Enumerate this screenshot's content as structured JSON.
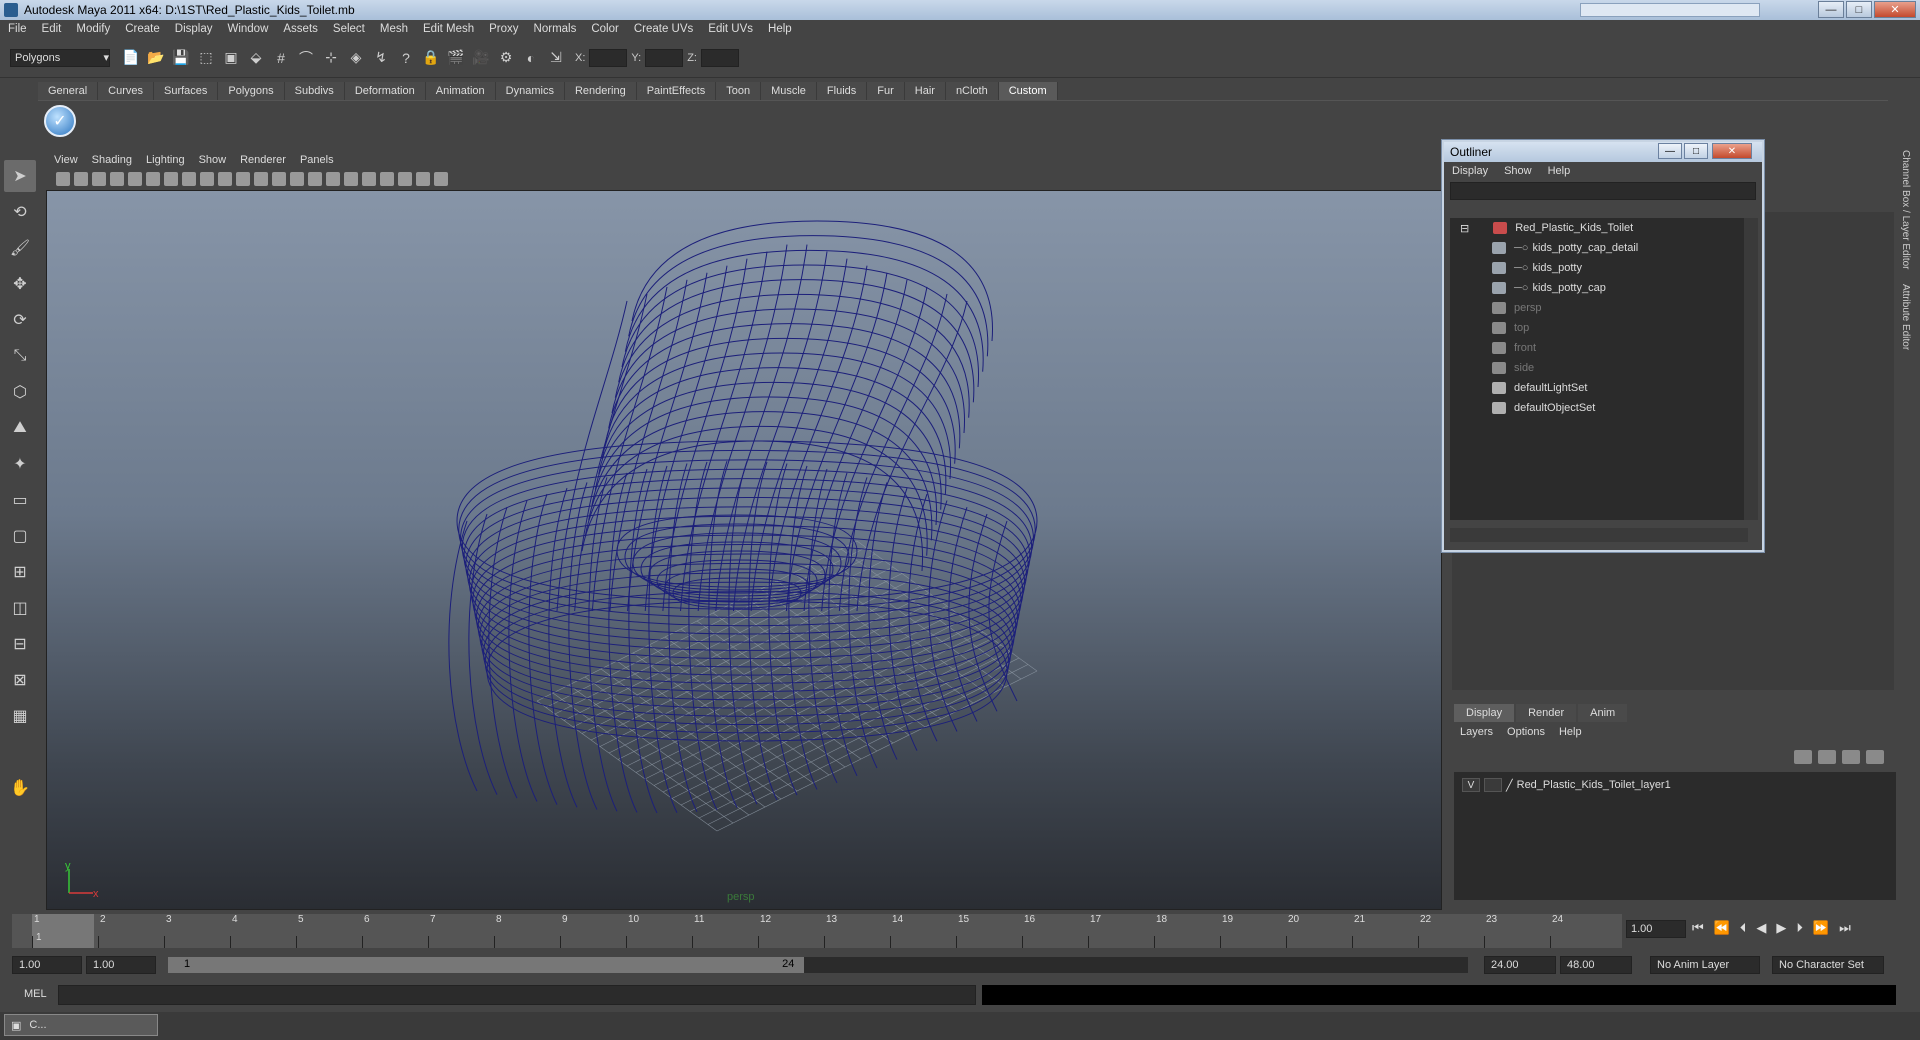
{
  "app": {
    "title": "Autodesk Maya 2011 x64: D:\\1ST\\Red_Plastic_Kids_Toilet.mb",
    "window_buttons": [
      "—",
      "□",
      "✕"
    ]
  },
  "menubar": [
    "File",
    "Edit",
    "Modify",
    "Create",
    "Display",
    "Window",
    "Assets",
    "Select",
    "Mesh",
    "Edit Mesh",
    "Proxy",
    "Normals",
    "Color",
    "Create UVs",
    "Edit UVs",
    "Help"
  ],
  "status_line": {
    "mode": "Polygons",
    "x_label": "X:",
    "y_label": "Y:",
    "z_label": "Z:"
  },
  "shelf": {
    "tabs": [
      "General",
      "Curves",
      "Surfaces",
      "Polygons",
      "Subdivs",
      "Deformation",
      "Animation",
      "Dynamics",
      "Rendering",
      "PaintEffects",
      "Toon",
      "Muscle",
      "Fluids",
      "Fur",
      "Hair",
      "nCloth",
      "Custom"
    ],
    "active_tab": "Custom"
  },
  "viewport": {
    "menu": [
      "View",
      "Shading",
      "Lighting",
      "Show",
      "Renderer",
      "Panels"
    ],
    "camera": "persp",
    "axis_y": "y",
    "axis_x": "x",
    "wire_color": "#1c1f7a"
  },
  "outliner": {
    "title": "Outliner",
    "menu": [
      "Display",
      "Show",
      "Help"
    ],
    "items": [
      {
        "label": "Red_Plastic_Kids_Toilet",
        "indent": 0,
        "dim": false,
        "icon": "transform-icon"
      },
      {
        "label": "kids_potty_cap_detail",
        "indent": 1,
        "dim": false,
        "icon": "mesh-icon"
      },
      {
        "label": "kids_potty",
        "indent": 1,
        "dim": false,
        "icon": "mesh-icon"
      },
      {
        "label": "kids_potty_cap",
        "indent": 1,
        "dim": false,
        "icon": "mesh-icon"
      },
      {
        "label": "persp",
        "indent": 0,
        "dim": true,
        "icon": "camera-icon"
      },
      {
        "label": "top",
        "indent": 0,
        "dim": true,
        "icon": "camera-icon"
      },
      {
        "label": "front",
        "indent": 0,
        "dim": true,
        "icon": "camera-icon"
      },
      {
        "label": "side",
        "indent": 0,
        "dim": true,
        "icon": "camera-icon"
      },
      {
        "label": "defaultLightSet",
        "indent": 0,
        "dim": false,
        "icon": "set-icon"
      },
      {
        "label": "defaultObjectSet",
        "indent": 0,
        "dim": false,
        "icon": "set-icon"
      }
    ]
  },
  "layer_editor": {
    "tabs": [
      "Display",
      "Render",
      "Anim"
    ],
    "active_tab": "Display",
    "menu": [
      "Layers",
      "Options",
      "Help"
    ],
    "layers": [
      {
        "visible": "V",
        "name": "Red_Plastic_Kids_Toilet_layer1"
      }
    ]
  },
  "side_tabs": [
    "Channel Box / Layer Editor",
    "Attribute Editor"
  ],
  "timeline": {
    "ticks": [
      "1",
      "2",
      "3",
      "4",
      "5",
      "6",
      "7",
      "8",
      "9",
      "10",
      "11",
      "12",
      "13",
      "14",
      "15",
      "16",
      "17",
      "18",
      "19",
      "20",
      "21",
      "22",
      "23",
      "24"
    ],
    "current_frame": "1",
    "current_frame_field": "1.00"
  },
  "range": {
    "start_time": "1.00",
    "playback_start": "1.00",
    "slider_start": "1",
    "slider_end": "24",
    "playback_end": "24.00",
    "end_time": "48.00",
    "anim_layer": "No Anim Layer",
    "character_set": "No Character Set"
  },
  "command_line": {
    "label": "MEL"
  },
  "taskbar": {
    "label": "C..."
  }
}
